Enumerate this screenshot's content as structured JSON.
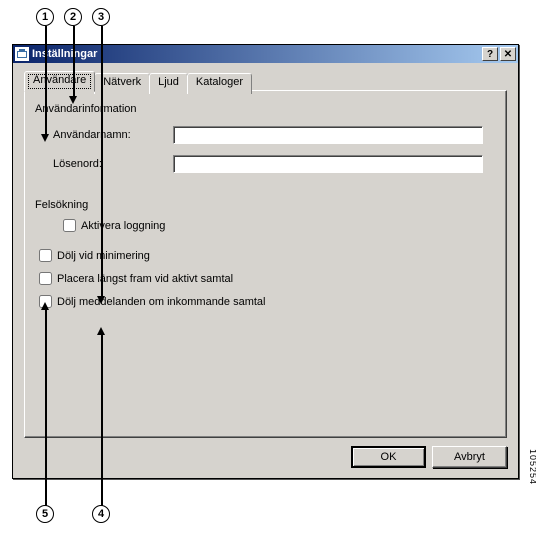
{
  "window": {
    "title": "Inställningar",
    "help_btn": "?",
    "close_btn": "✕"
  },
  "tabs": [
    "Användare",
    "Nätverk",
    "Ljud",
    "Kataloger"
  ],
  "group_user_info": "Användarinformation",
  "label_username": "Användarnamn:",
  "label_password": "Lösenord:",
  "value_username": "",
  "value_password": "",
  "group_debug": "Felsökning",
  "cb_enable_logging": "Aktivera loggning",
  "cb_hide_minimize": "Dölj vid minimering",
  "cb_bring_front": "Placera längst fram vid aktivt samtal",
  "cb_hide_incoming": "Dölj meddelanden om inkommande samtal",
  "btn_ok": "OK",
  "btn_cancel": "Avbryt",
  "callouts": {
    "c1": "1",
    "c2": "2",
    "c3": "3",
    "c4": "4",
    "c5": "5"
  },
  "figure_id": "105254"
}
